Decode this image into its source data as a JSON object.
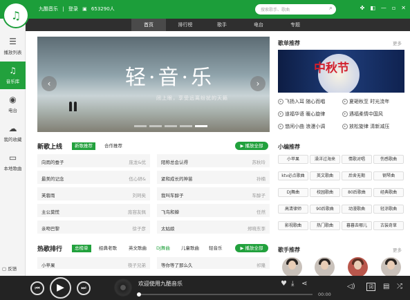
{
  "app": {
    "name": "九酷音乐",
    "separator": "|",
    "login": "登录",
    "coin": "653290人"
  },
  "search": {
    "placeholder": "搜索歌手、歌曲"
  },
  "nav": {
    "tabs": [
      {
        "label": "首页",
        "active": true
      },
      {
        "label": "排行榜"
      },
      {
        "label": "歌手"
      },
      {
        "label": "电台"
      },
      {
        "label": "专题"
      }
    ]
  },
  "sidebar": {
    "items": [
      {
        "label": "播放列表",
        "icon": "list-icon"
      },
      {
        "label": "音乐库",
        "icon": "music-note-icon",
        "active": true
      },
      {
        "label": "电台",
        "icon": "radio-icon"
      },
      {
        "label": "我的收藏",
        "icon": "cloud-icon"
      },
      {
        "label": "本地歌曲",
        "icon": "computer-icon"
      }
    ],
    "feedback": "反馈"
  },
  "banner": {
    "title": "轻·音·乐",
    "subtitle": "闭上眼，享受远离纷扰的天籁"
  },
  "new_songs": {
    "title": "新歌上线",
    "tabs": [
      {
        "label": "新歌推荐",
        "active": true
      },
      {
        "label": "合作推荐"
      }
    ],
    "play_all": "播放全部",
    "list": [
      {
        "song": "向雨的蚕子",
        "artist": "庞龙&优"
      },
      {
        "song": "陌称总会认得",
        "artist": "苏秋玲"
      },
      {
        "song": "最美的记念",
        "artist": "伍心研&"
      },
      {
        "song": "紧和成长的神苗",
        "artist": "孙楠"
      },
      {
        "song": "芙蓉雨",
        "artist": "刘珂矣"
      },
      {
        "song": "我叫车醇子",
        "artist": "车醇子"
      },
      {
        "song": "主公莫慌",
        "artist": "庞容友佩"
      },
      {
        "song": "飞鸟和蝉",
        "artist": "任然"
      },
      {
        "song": "亲吻巴黎",
        "artist": "徐子彦"
      },
      {
        "song": "太姑娘",
        "artist": "郑晓东李"
      }
    ]
  },
  "charts": {
    "title": "热歌排行",
    "tabs": [
      {
        "label": "总榜单",
        "active": true
      },
      {
        "label": "经典老歌"
      },
      {
        "label": "英文歌曲"
      },
      {
        "label": "DJ舞曲",
        "accent": true
      },
      {
        "label": "儿童歌曲"
      },
      {
        "label": "轻音乐"
      }
    ],
    "play_all": "播放全部",
    "list": [
      {
        "song": "小苹果",
        "artist": "筷子兄弟"
      },
      {
        "song": "等你等了那么久",
        "artist": "祁隆"
      }
    ]
  },
  "playlist_rec": {
    "title": "歌单推荐",
    "more": "更多",
    "image_text": "中秋节",
    "links": [
      "飞扬入耳 随心而唱",
      "夏砸秋至 时光流年",
      "道福华语 暖心旋律",
      "遇福柔情中国风",
      "悠闲小曲 浪漫小调",
      "放松旋律 清新减压"
    ]
  },
  "editor_rec": {
    "title": "小编推荐",
    "tags": [
      "小苹果",
      "澡洋过海来",
      "情歌对唱",
      "伤感歌曲",
      "ktv必点歌曲",
      "英文歌曲",
      "后舍无期",
      "钢琴曲",
      "DJ舞曲",
      "校园歌曲",
      "80后歌曲",
      "经典歌曲",
      "高清律师",
      "90后歌曲",
      "动漫歌曲",
      "轻涼歌曲",
      "影视歌曲",
      "热门歌曲",
      "暮暮去哪儿",
      "古装奇草"
    ]
  },
  "singer_rec": {
    "title": "歌手推荐",
    "more": "更多"
  },
  "player": {
    "now_playing": "欢迎使用九酷音乐",
    "time": "00:00",
    "progress": 0,
    "mode_label": "词"
  }
}
